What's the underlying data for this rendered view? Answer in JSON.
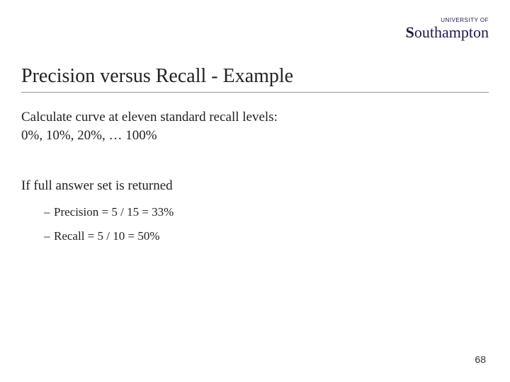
{
  "logo": {
    "top": "UNIVERSITY OF",
    "main_prefix": "S",
    "main_rest": "outhampton"
  },
  "title": "Precision versus Recall - Example",
  "body": {
    "line1": "Calculate curve at eleven standard recall levels:",
    "line2": "0%, 10%, 20%, … 100%",
    "line3": "If full answer set is returned",
    "bullet1": "Precision = 5 / 15 = 33%",
    "bullet2": "Recall = 5 / 10 = 50%"
  },
  "page_number": "68"
}
